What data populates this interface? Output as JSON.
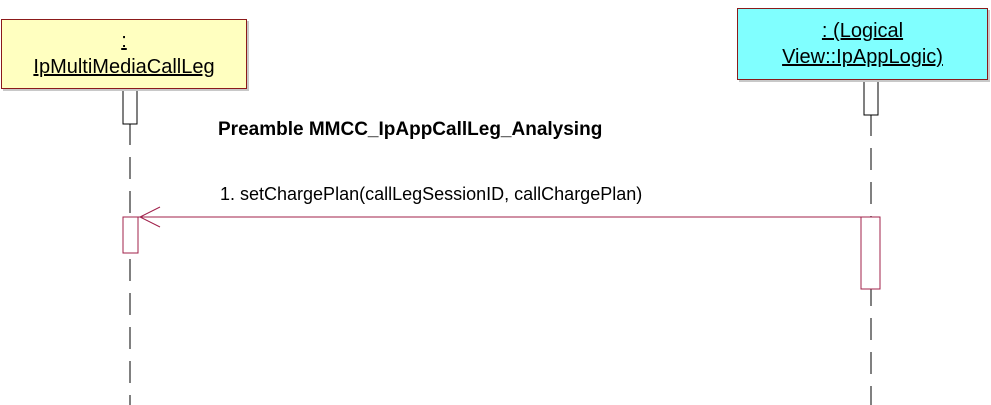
{
  "lifelines": [
    {
      "id": "left",
      "lines": [
        ":",
        "IpMultiMediaCallLeg"
      ],
      "fill": "#ffffc0"
    },
    {
      "id": "right",
      "lines": [
        ": (Logical",
        "View::IpAppLogic)"
      ],
      "fill": "#80ffff"
    }
  ],
  "frame_title": "Preamble MMCC_IpAppCallLeg_Analysing",
  "messages": [
    {
      "label": "1. setChargePlan(callLegSessionID, callChargePlan)",
      "from": "right",
      "to": "left"
    }
  ],
  "colors": {
    "border": "#8b1a1a",
    "lifeline": "#000000",
    "message": "#a0204a"
  }
}
